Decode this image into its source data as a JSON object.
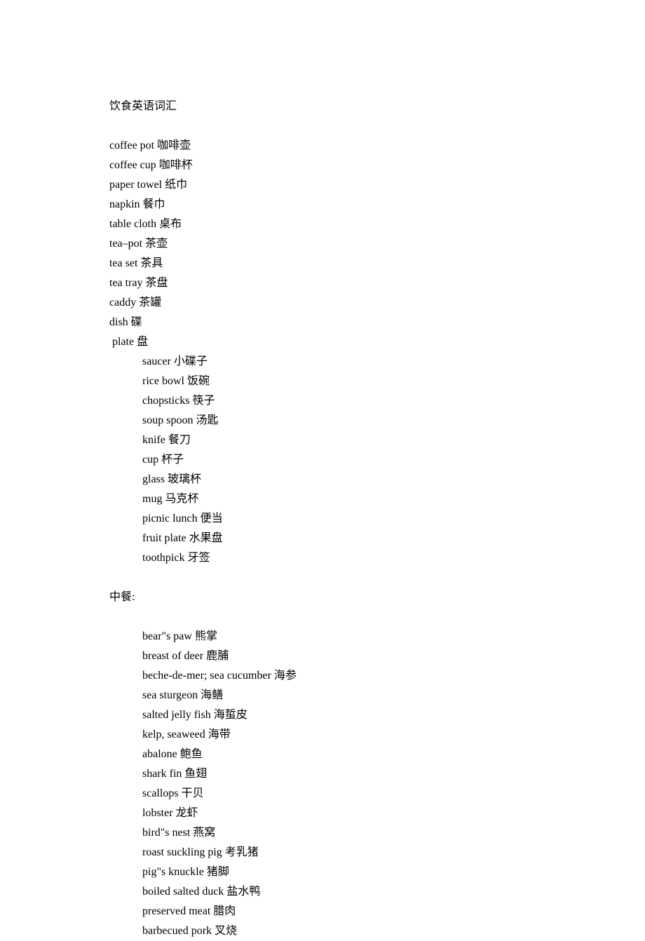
{
  "title": "饮食英语词汇",
  "section1_items": [
    "coffee pot 咖啡壶",
    "coffee cup 咖啡杯",
    "paper towel 纸巾",
    "napkin 餐巾",
    "table cloth 桌布",
    "tea–pot 茶壶",
    "tea set 茶具",
    "tea tray 茶盘",
    "caddy 茶罐",
    "dish 碟"
  ],
  "section1_plate": " plate 盘",
  "section1_indented": [
    "saucer 小碟子",
    "rice bowl 饭碗",
    "chopsticks 筷子",
    "soup spoon 汤匙",
    "knife 餐刀",
    "cup 杯子",
    "glass 玻璃杯",
    "mug 马克杯",
    "picnic lunch 便当",
    "fruit plate 水果盘",
    "toothpick 牙签"
  ],
  "section2_header": "中餐:",
  "section2_items": [
    "bear\"s paw 熊掌",
    "breast of deer 鹿脯",
    "beche-de-mer; sea cucumber 海参",
    "sea sturgeon 海鳝",
    "salted jelly fish 海蜇皮",
    "kelp, seaweed 海带",
    "abalone 鲍鱼",
    "shark fin 鱼翅",
    "scallops 干贝",
    "lobster 龙虾",
    "bird\"s nest 燕窝",
    "roast suckling pig 考乳猪",
    "pig\"s knuckle 猪脚",
    "boiled salted duck 盐水鸭",
    "preserved meat 腊肉",
    "barbecued pork 叉烧"
  ]
}
